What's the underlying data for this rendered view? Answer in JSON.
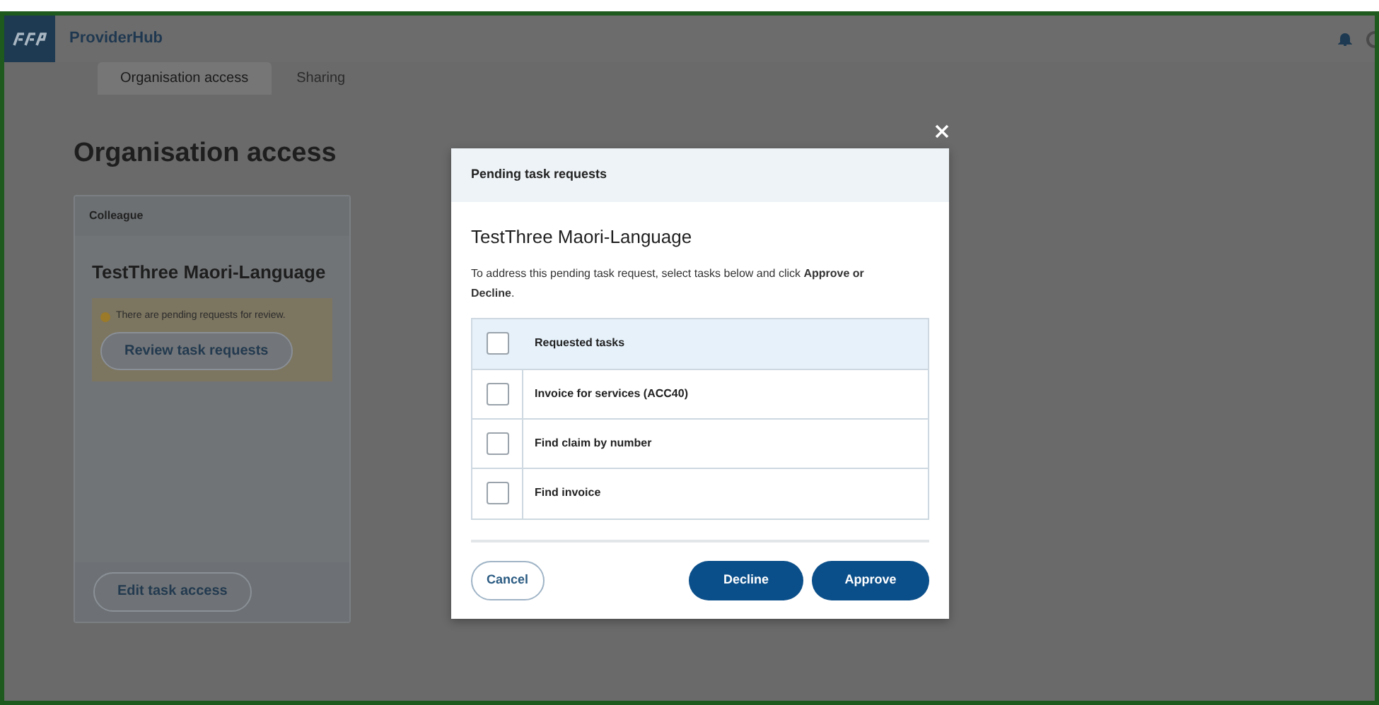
{
  "app": {
    "name": "ProviderHub"
  },
  "tabs": [
    {
      "label": "Organisation access",
      "selected": true
    },
    {
      "label": "Sharing",
      "selected": false
    }
  ],
  "page_title": "Organisation access",
  "colleague_card": {
    "header": "Colleague",
    "name": "TestThree Maori-Language",
    "alert": "There are pending requests for review.",
    "review_button": "Review task requests",
    "edit_button": "Edit task access"
  },
  "dialog": {
    "header": "Pending task requests",
    "title": "TestThree Maori-Language",
    "description": "To address this pending task request, select tasks below and click **Approve or Decline**.",
    "table_header": {
      "label": "Requested tasks",
      "checked": false
    },
    "tasks": [
      {
        "label": "Invoice for services (ACC40)",
        "checked": false
      },
      {
        "label": "Find claim by number",
        "checked": false
      },
      {
        "label": "Find invoice",
        "checked": false
      }
    ],
    "buttons": {
      "cancel": "Cancel",
      "decline": "Decline",
      "approve": "Approve"
    }
  }
}
